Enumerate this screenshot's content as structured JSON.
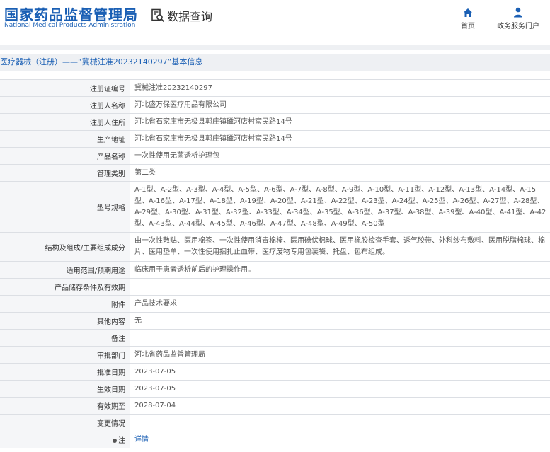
{
  "header": {
    "logo_cn": "国家药品监督管理局",
    "logo_en": "National Medical Products Administration",
    "query_label": "数据查询",
    "nav_home": "首页",
    "nav_portal": "政务服务门户"
  },
  "breadcrumb": "医疗器械（注册）——“冀械注准20232140297”基本信息",
  "rows": [
    {
      "key": "注册证编号",
      "value": "冀械注准20232140297"
    },
    {
      "key": "注册人名称",
      "value": "河北盛万保医疗用品有限公司"
    },
    {
      "key": "注册人住所",
      "value": "河北省石家庄市无极县郭庄镇磁河店村富民路14号"
    },
    {
      "key": "生产地址",
      "value": "河北省石家庄市无极县郭庄镇磁河店村富民路14号"
    },
    {
      "key": "产品名称",
      "value": "一次性使用无菌透析护理包"
    },
    {
      "key": "管理类别",
      "value": "第二类"
    },
    {
      "key": "型号规格",
      "value": "A-1型、A-2型、A-3型、A-4型、A-5型、A-6型、A-7型、A-8型、A-9型、A-10型、A-11型、A-12型、A-13型、A-14型、A-15型、A-16型、A-17型、A-18型、A-19型、A-20型、A-21型、A-22型、A-23型、A-24型、A-25型、A-26型、A-27型、A-28型、A-29型、A-30型、A-31型、A-32型、A-33型、A-34型、A-35型、A-36型、A-37型、A-38型、A-39型、A-40型、A-41型、A-42型、A-43型、A-44型、A-45型、A-46型、A-47型、A-48型、A-49型、A-50型"
    },
    {
      "key": "结构及组成/主要组成成分",
      "value": "由一次性敷贴、医用棉签、一次性使用消毒棉棒、医用碘伏棉球、医用橡胶检查手套、透气胶带、外科纱布敷料、医用脱脂棉球、棉片、医用垫单、一次性使用捆扎止血带、医疗废物专用包装袋、托盘、包布组成。"
    },
    {
      "key": "适用范围/预期用途",
      "value": "临床用于患者透析前后的护理操作用。"
    },
    {
      "key": "产品储存条件及有效期",
      "value": ""
    },
    {
      "key": "附件",
      "value": "产品技术要求"
    },
    {
      "key": "其他内容",
      "value": "无"
    },
    {
      "key": "备注",
      "value": ""
    },
    {
      "key": "审批部门",
      "value": "河北省药品监督管理局"
    },
    {
      "key": "批准日期",
      "value": "2023-07-05"
    },
    {
      "key": "生效日期",
      "value": "2023-07-05"
    },
    {
      "key": "有效期至",
      "value": "2028-07-04"
    },
    {
      "key": "变更情况",
      "value": ""
    },
    {
      "key": "注",
      "value": "详情"
    }
  ],
  "colors": {
    "brand": "#1a5fb4",
    "link": "#1a5fb4",
    "label_bg": "#f5f6f8",
    "border": "#dcdfe4"
  }
}
